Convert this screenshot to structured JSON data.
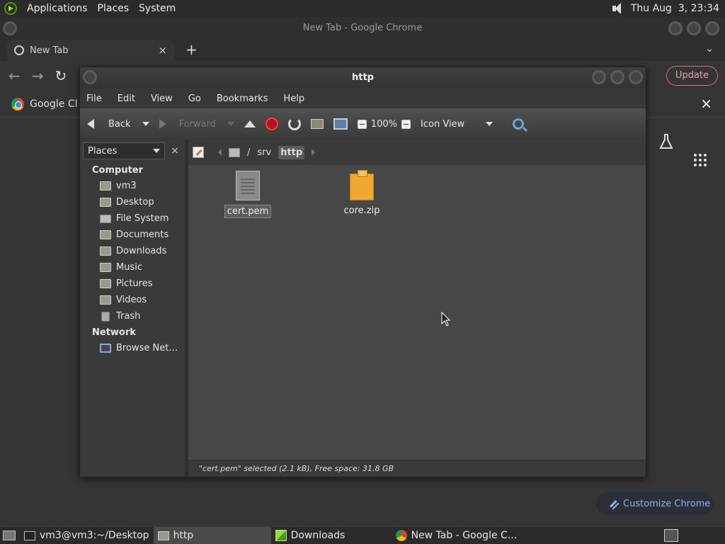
{
  "top_panel": {
    "menus": [
      "Applications",
      "Places",
      "System"
    ],
    "clock": "Thu Aug  3, 23:34"
  },
  "chrome": {
    "window_title": "New Tab - Google Chrome",
    "tab_title": "New Tab",
    "tab_close": "×",
    "new_tab": "+",
    "tab_menu": "⌄",
    "update_label": "Update",
    "bookmark_label": "Google Cl",
    "bookmarks_close": "×",
    "customize_label": "Customize Chrome"
  },
  "file_manager": {
    "title": "http",
    "menus": [
      "File",
      "Edit",
      "View",
      "Go",
      "Bookmarks",
      "Help"
    ],
    "toolbar": {
      "back_label": "Back",
      "forward_label": "Forward",
      "zoom_level": "100%",
      "view_mode": "Icon View"
    },
    "sidebar": {
      "selector_label": "Places",
      "close": "×",
      "sections": [
        {
          "title": "Computer",
          "items": [
            {
              "label": "vm3",
              "icon": "home-folder-icon"
            },
            {
              "label": "Desktop",
              "icon": "desktop-folder-icon"
            },
            {
              "label": "File System",
              "icon": "drive-icon"
            },
            {
              "label": "Documents",
              "icon": "documents-folder-icon"
            },
            {
              "label": "Downloads",
              "icon": "downloads-folder-icon"
            },
            {
              "label": "Music",
              "icon": "music-folder-icon"
            },
            {
              "label": "Pictures",
              "icon": "pictures-folder-icon"
            },
            {
              "label": "Videos",
              "icon": "videos-folder-icon"
            },
            {
              "label": "Trash",
              "icon": "trash-icon"
            }
          ]
        },
        {
          "title": "Network",
          "items": [
            {
              "label": "Browse Net…",
              "icon": "network-icon"
            }
          ]
        }
      ]
    },
    "path": {
      "separator": "/",
      "crumbs": [
        "srv",
        "http"
      ]
    },
    "files": [
      {
        "name": "cert.pem",
        "selected": true
      },
      {
        "name": "core.zip",
        "selected": false
      }
    ],
    "status": "\"cert.pem\" selected (2.1 kB), Free space: 31.8 GB"
  },
  "taskbar": {
    "tasks": [
      {
        "label": "vm3@vm3:~/Desktop",
        "active": false
      },
      {
        "label": "http",
        "active": true
      },
      {
        "label": "Downloads",
        "active": false
      },
      {
        "label": "New Tab - Google C...",
        "active": false
      }
    ]
  }
}
